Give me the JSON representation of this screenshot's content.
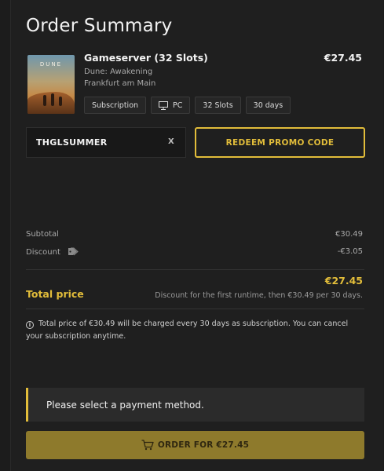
{
  "summary": {
    "title": "Order Summary"
  },
  "item": {
    "name": "Gameserver (32 Slots)",
    "game": "Dune: Awakening",
    "location": "Frankfurt am Main",
    "price": "€27.45",
    "cover_logo": "DUNE",
    "tags": {
      "type": "Subscription",
      "platform": "PC",
      "slots": "32 Slots",
      "duration": "30 days"
    }
  },
  "promo": {
    "code": "THGLSUMMER",
    "clear_label": "X",
    "redeem_label": "REDEEM PROMO CODE"
  },
  "totals": {
    "subtotal_label": "Subtotal",
    "subtotal_value": "€30.49",
    "discount_label": "Discount",
    "discount_value": "-€3.05",
    "total_label": "Total price",
    "total_value": "€27.45",
    "total_note": "Discount for the first runtime, then €30.49 per 30 days."
  },
  "info_text": "Total price of €30.49 will be charged every 30 days as subscription. You can cancel your subscription anytime.",
  "payment_notice": "Please select a payment method.",
  "order_button": "ORDER FOR €27.45",
  "colors": {
    "accent": "#e2bd3a",
    "background": "#1f1f1f",
    "order_button": "#8e7a2c"
  }
}
